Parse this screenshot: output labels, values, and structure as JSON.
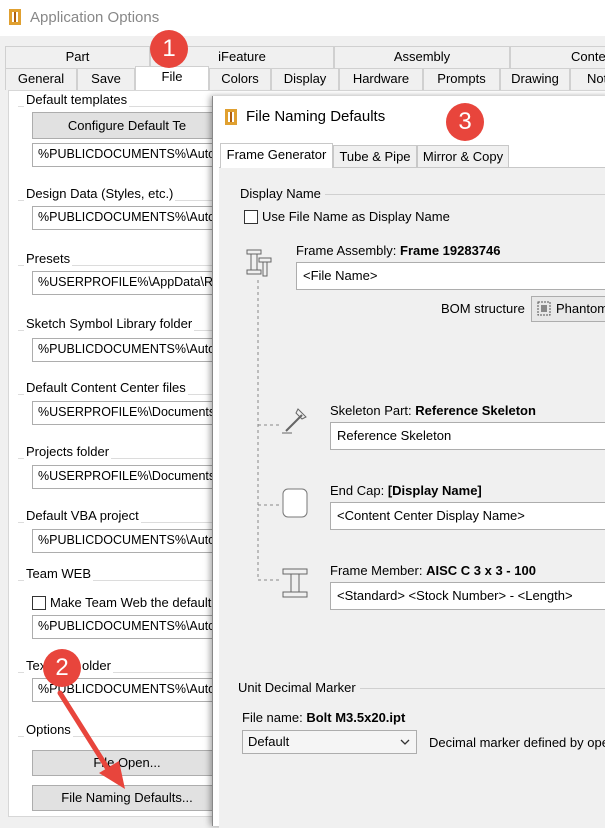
{
  "app": {
    "title": "Application Options",
    "top_tabs": [
      "Part",
      "iFeature",
      "Assembly",
      "Conte"
    ],
    "bottom_tabs": [
      "General",
      "Save",
      "File",
      "Colors",
      "Display",
      "Hardware",
      "Prompts",
      "Drawing",
      "Not"
    ]
  },
  "file_tab": {
    "default_templates": {
      "label": "Default templates",
      "button": "Configure Default Te",
      "path": "%PUBLICDOCUMENTS%\\Autod"
    },
    "design_data": {
      "label": "Design Data (Styles, etc.)",
      "path": "%PUBLICDOCUMENTS%\\Autod"
    },
    "presets": {
      "label": "Presets",
      "path": "%USERPROFILE%\\AppData\\Ro"
    },
    "sketch_symbol": {
      "label": "Sketch Symbol Library folder",
      "path": "%PUBLICDOCUMENTS%\\Autod"
    },
    "content_center": {
      "label": "Default Content Center files",
      "path": "%USERPROFILE%\\Documents\\"
    },
    "projects": {
      "label": "Projects folder",
      "path": "%USERPROFILE%\\Documents\\"
    },
    "vba": {
      "label": "Default VBA project",
      "path": "%PUBLICDOCUMENTS%\\Autod"
    },
    "team_web": {
      "label": "Team WEB",
      "checkbox": "Make Team Web the default",
      "path": "%PUBLICDOCUMENTS%\\Autod"
    },
    "text_folder": {
      "label": "Text folder",
      "label_visible": "Tex",
      "label_tail": "older",
      "path": "%PUBLICDOCUMENTS%\\Autod"
    },
    "options": {
      "label": "Options",
      "file_open": "File Open...",
      "file_naming": "File Naming Defaults..."
    }
  },
  "dialog": {
    "title": "File Naming Defaults",
    "tabs": [
      "Frame Generator",
      "Tube & Pipe",
      "Mirror & Copy"
    ],
    "display_name_heading": "Display Name",
    "use_file_name": "Use File Name as Display Name",
    "frame_assembly": {
      "label": "Frame Assembly:",
      "value_bold": "Frame 19283746",
      "field": "<File Name>"
    },
    "bom": {
      "label": "BOM structure",
      "value": "Phantom"
    },
    "skeleton": {
      "label": "Skeleton Part:",
      "value_bold": "Reference Skeleton",
      "field": "Reference Skeleton"
    },
    "end_cap": {
      "label": "End Cap:",
      "value_bold": "[Display Name]",
      "field": "<Content Center Display Name>"
    },
    "frame_member": {
      "label": "Frame Member:",
      "value_bold": "AISC C 3 x 3 - 100",
      "field": "<Standard> <Stock Number> - <Length>"
    },
    "unit_decimal": {
      "heading": "Unit Decimal Marker",
      "file_name_label": "File name:",
      "file_name_value": "Bolt M3.5x20.ipt",
      "select": "Default",
      "desc": "Decimal marker defined by ope"
    }
  },
  "annotations": {
    "badge1": "1",
    "badge2": "2",
    "badge3": "3"
  },
  "colors": {
    "badge": "#e8453c",
    "arrow": "#e8453c",
    "app_icon": "#e0a030"
  }
}
